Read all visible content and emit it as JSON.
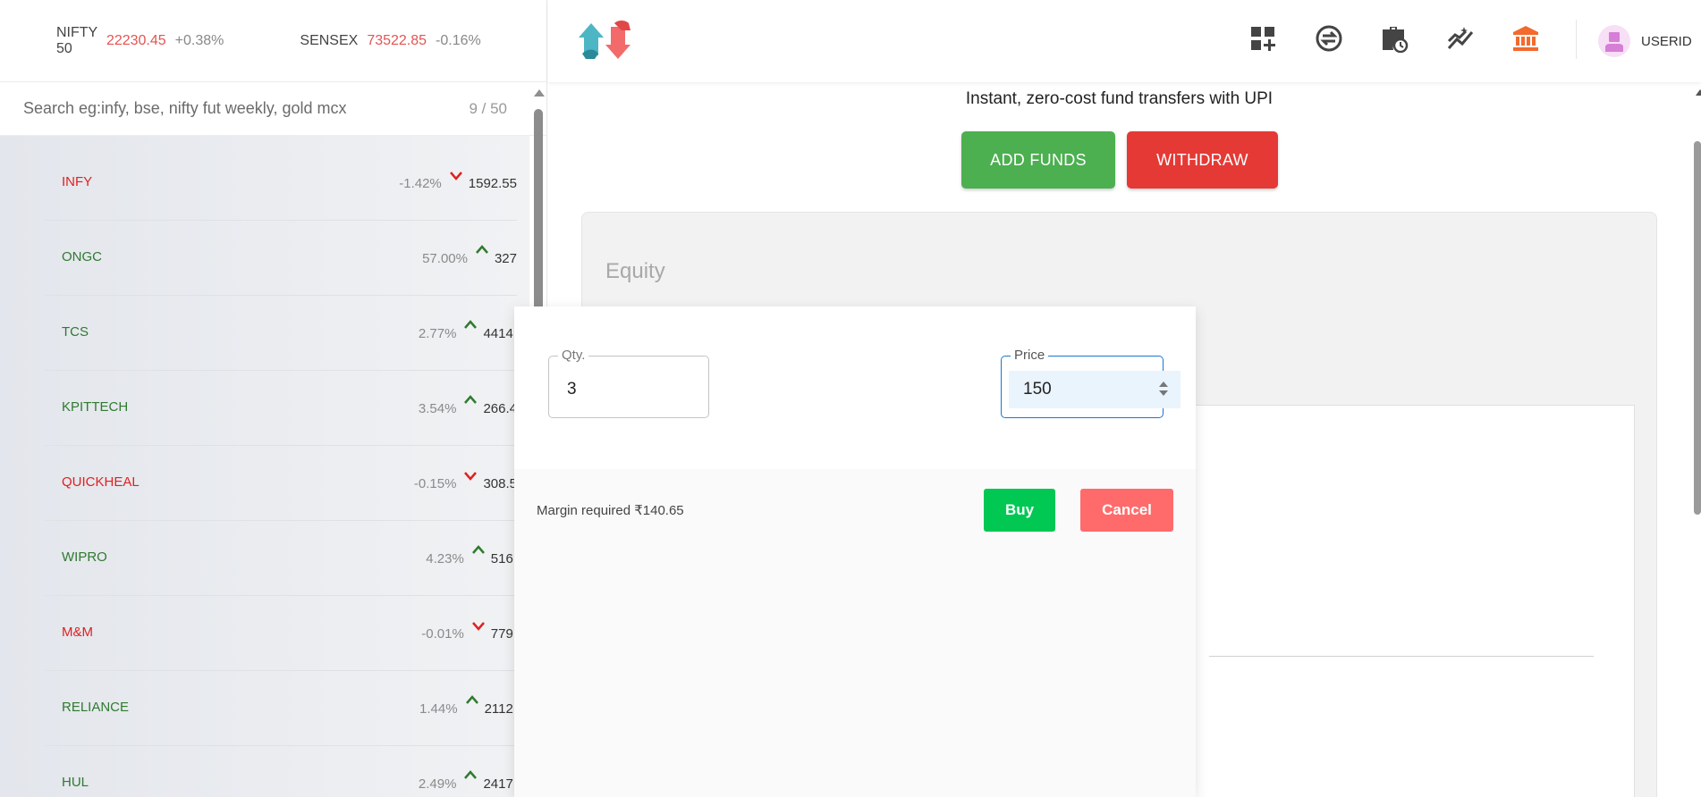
{
  "indices": [
    {
      "name": "NIFTY 50",
      "value": "22230.45",
      "change": "+0.38%"
    },
    {
      "name": "SENSEX",
      "value": "73522.85",
      "change": "-0.16%"
    }
  ],
  "search": {
    "placeholder": "Search eg:infy, bse, nifty fut weekly, gold mcx",
    "count": "9 / 50"
  },
  "watchlist": [
    {
      "name": "INFY",
      "pct": "-1.42%",
      "price": "1592.55",
      "dir": "down"
    },
    {
      "name": "ONGC",
      "pct": "57.00%",
      "price": "327",
      "dir": "up"
    },
    {
      "name": "TCS",
      "pct": "2.77%",
      "price": "4414.",
      "dir": "up"
    },
    {
      "name": "KPITTECH",
      "pct": "3.54%",
      "price": "266.4",
      "dir": "up"
    },
    {
      "name": "QUICKHEAL",
      "pct": "-0.15%",
      "price": "308.5",
      "dir": "down"
    },
    {
      "name": "WIPRO",
      "pct": "4.23%",
      "price": "516.",
      "dir": "up"
    },
    {
      "name": "M&M",
      "pct": "-0.01%",
      "price": "779.",
      "dir": "down"
    },
    {
      "name": "RELIANCE",
      "pct": "1.44%",
      "price": "2112.",
      "dir": "up"
    },
    {
      "name": "HUL",
      "pct": "2.49%",
      "price": "2417.",
      "dir": "up"
    }
  ],
  "header": {
    "icons": [
      "dashboard-add-icon",
      "orders-exchange-icon",
      "portfolio-history-icon",
      "analytics-icon",
      "funds-bank-icon"
    ],
    "user": "USERID",
    "active_color": "#f26a2e"
  },
  "funds": {
    "upi_text": "Instant, zero-cost fund transfers with UPI",
    "add_label": "ADD FUNDS",
    "withdraw_label": "WITHDRAW",
    "equity_title": "Equity"
  },
  "order": {
    "qty_label": "Qty.",
    "qty_value": "3",
    "price_label": "Price",
    "price_value": "150",
    "margin_text": "Margin required ₹140.65",
    "buy_label": "Buy",
    "cancel_label": "Cancel"
  },
  "colors": {
    "up": "#2f7a2f",
    "down": "#e02020",
    "buy": "#00c853",
    "cancel": "#ff6b6b",
    "add": "#4caf50",
    "withdraw": "#e53935"
  }
}
